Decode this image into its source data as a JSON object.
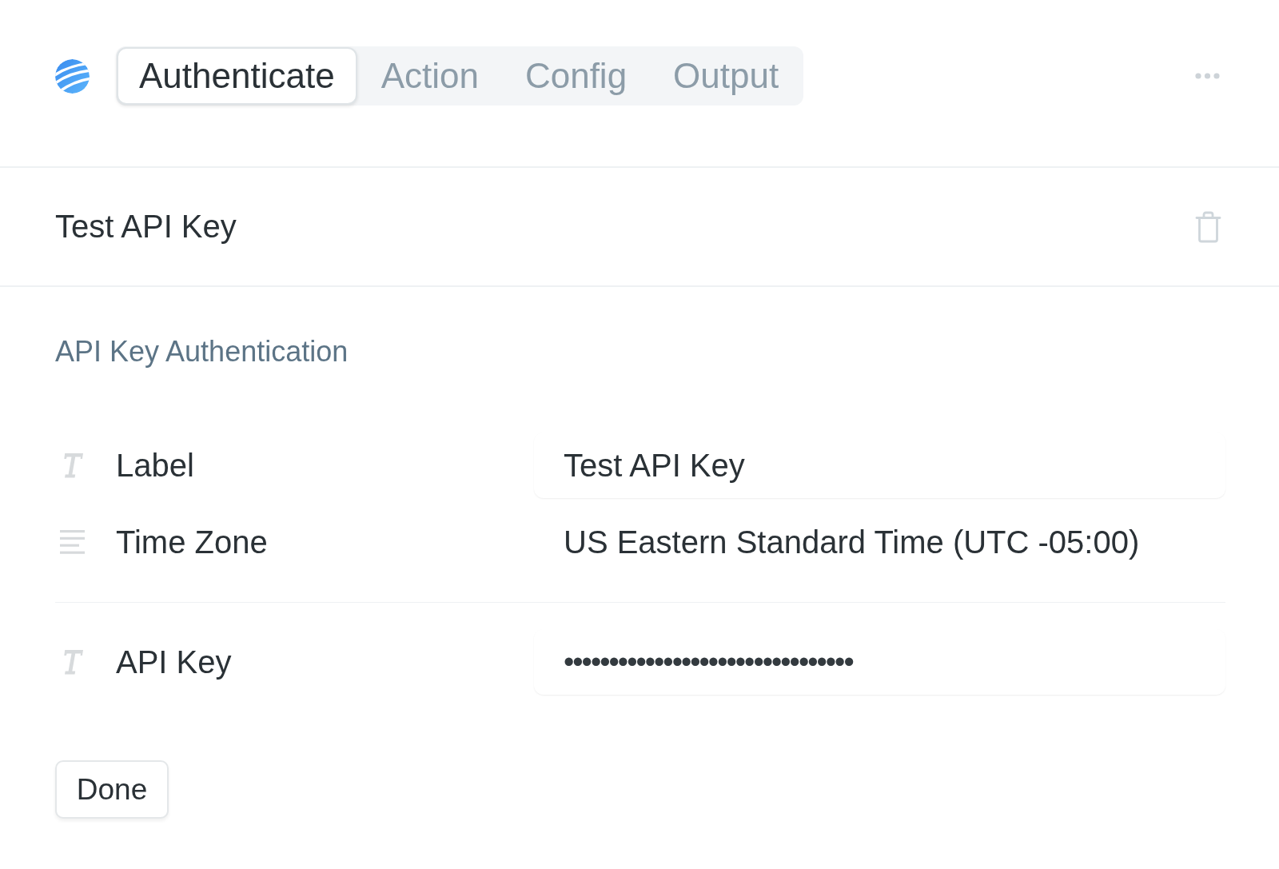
{
  "tabs": [
    {
      "label": "Authenticate",
      "selected": true
    },
    {
      "label": "Action",
      "selected": false
    },
    {
      "label": "Config",
      "selected": false
    },
    {
      "label": "Output",
      "selected": false
    }
  ],
  "record": {
    "title": "Test API Key"
  },
  "section": {
    "title": "API Key Authentication",
    "field_groups": [
      {
        "fields": [
          {
            "kind": "text",
            "label": "Label",
            "value": "Test API Key"
          },
          {
            "kind": "select",
            "label": "Time Zone",
            "value": "US Eastern Standard Time (UTC -05:00)"
          }
        ]
      },
      {
        "fields": [
          {
            "kind": "secret",
            "label": "API Key",
            "value": "••••••••••••••••••••••••••••••••"
          }
        ]
      }
    ]
  },
  "buttons": [
    "Done"
  ]
}
